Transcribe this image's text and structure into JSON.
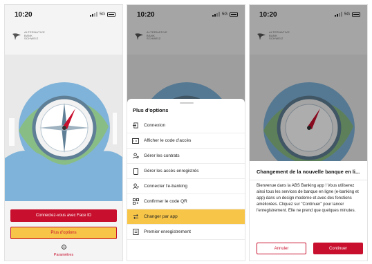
{
  "status": {
    "time": "10:20",
    "network": "5G"
  },
  "brand": {
    "line1": "ALTERNATIVE",
    "line2": "BANK",
    "line3": "SCHWEIZ",
    "color": "#c8102e"
  },
  "screen1": {
    "face_id_label": "Connectez-vous avec Face ID",
    "options_label": "Plus d'options",
    "settings_label": "Paramètres"
  },
  "screen2": {
    "sheet_title": "Plus d'options",
    "items": [
      {
        "label": "Connexion",
        "icon": "login-icon"
      },
      {
        "label": "Afficher le code d'accès",
        "icon": "code-icon"
      },
      {
        "label": "Gérer les contrats",
        "icon": "contracts-icon"
      },
      {
        "label": "Gérer les accès enregistrés",
        "icon": "phone-icon"
      },
      {
        "label": "Connecter l'e-banking",
        "icon": "link-user-icon"
      },
      {
        "label": "Confirmer le code QR",
        "icon": "qr-icon"
      },
      {
        "label": "Changer par app",
        "icon": "swap-icon"
      },
      {
        "label": "Premier enregistrement",
        "icon": "register-icon"
      }
    ],
    "highlight_color": "#f7c548"
  },
  "screen3": {
    "dialog_title": "Changement de la nouvelle banque en li...",
    "dialog_body": "Bienvenue dans la ABS Banking app ! Vous utiliserez ainsi tous les services de banque en ligne (e-banking et app) dans un design moderne et avec des fonctions améliorées. Cliquez sur \"Continuer\" pour lancer l'enregistrement. Elle ne prend que quelques minutes.",
    "cancel_label": "Annuler",
    "continue_label": "Continuer"
  }
}
